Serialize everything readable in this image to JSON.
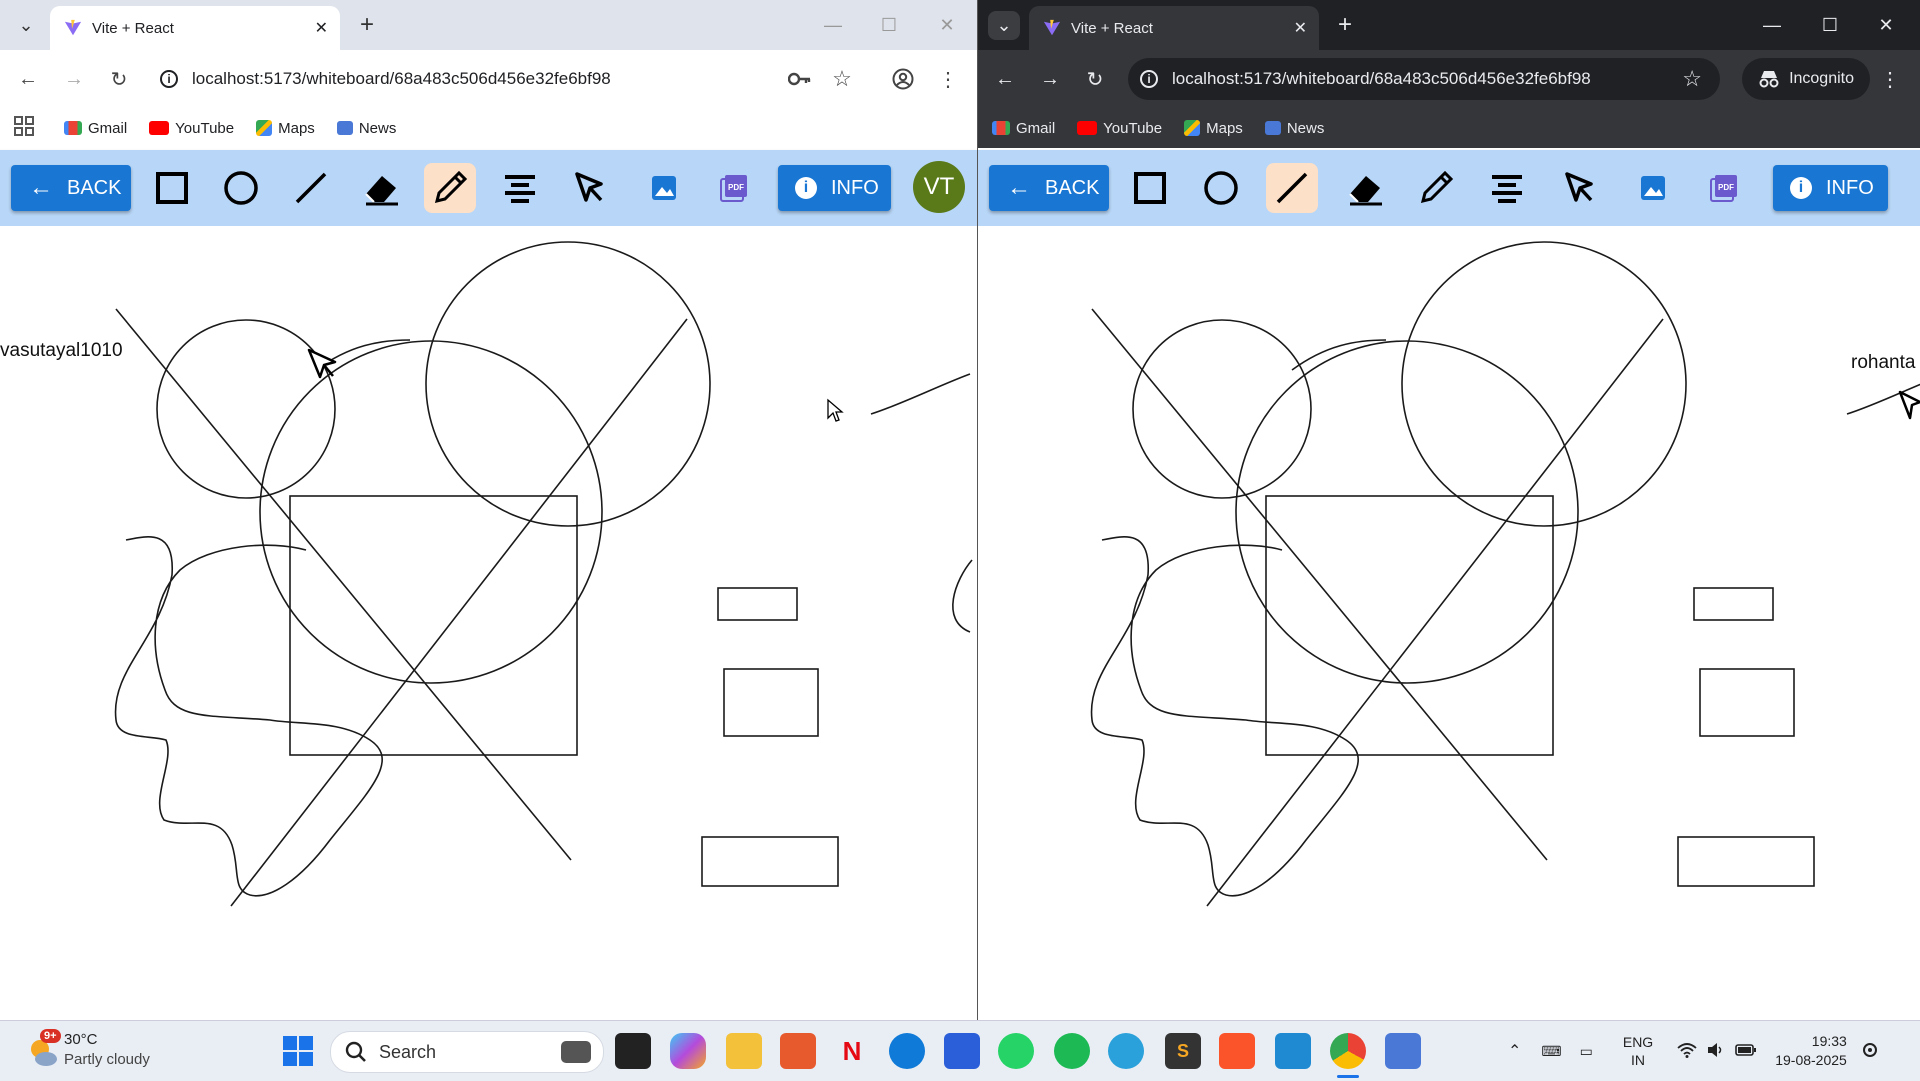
{
  "left_window": {
    "tab": {
      "title": "Vite + React",
      "close": "✕"
    },
    "tab_dropdown": "⌄",
    "new_tab": "+",
    "window_controls": {
      "minimize": "—",
      "maximize": "☐",
      "close": "✕"
    },
    "address": "localhost:5173/whiteboard/68a483c506d456e32fe6bf98",
    "bookmarks": [
      "Gmail",
      "YouTube",
      "Maps",
      "News"
    ],
    "toolbar": {
      "back_label": "BACK",
      "info_label": "INFO",
      "avatar_initials": "VT",
      "active_tool": "pencil"
    },
    "remote_cursor_label": "vasutayal1010"
  },
  "right_window": {
    "tab": {
      "title": "Vite + React",
      "close": "✕"
    },
    "tab_dropdown": "⌄",
    "new_tab": "+",
    "window_controls": {
      "minimize": "—",
      "maximize": "☐",
      "close": "✕"
    },
    "address": "localhost:5173/whiteboard/68a483c506d456e32fe6bf98",
    "incognito_label": "Incognito",
    "bookmarks": [
      "Gmail",
      "YouTube",
      "Maps",
      "News"
    ],
    "toolbar": {
      "back_label": "BACK",
      "info_label": "INFO",
      "active_tool": "line"
    },
    "remote_cursor_label": "rohanta"
  },
  "taskbar": {
    "weather": {
      "temp": "30°C",
      "condition": "Partly cloudy",
      "badge": "9+"
    },
    "search_placeholder": "Search",
    "tray": {
      "lang_top": "ENG",
      "lang_bottom": "IN",
      "time": "19:33",
      "date": "19-08-2025"
    }
  },
  "colors": {
    "toolbar_bg": "#b8d6f7",
    "button_blue": "#1976d2",
    "active_tool": "#fce0c8",
    "avatar": "#5a7a1a"
  }
}
